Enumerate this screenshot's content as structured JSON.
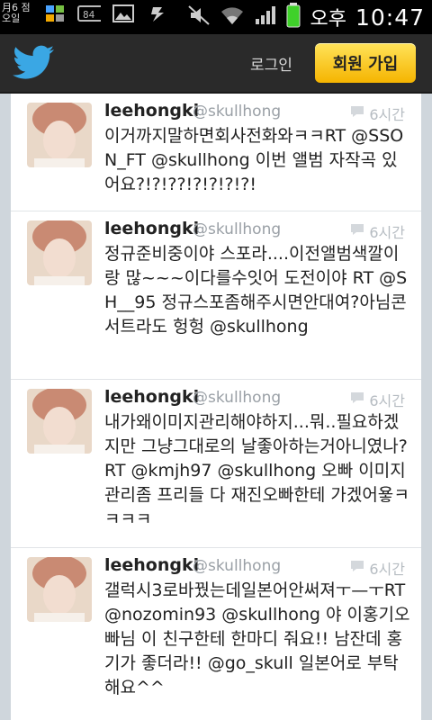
{
  "status_bar": {
    "left_text": "月6 점오일",
    "signal_label": "84",
    "time_ampm": "오후",
    "time": "10:47",
    "battery_color": "#3fd12a"
  },
  "header": {
    "logo_icon": "twitter-bird-icon",
    "login_label": "로그인",
    "signup_label": "회원 가입",
    "accent": "#f5b400"
  },
  "tweets": [
    {
      "name": "leehongki",
      "handle": "@skullhong",
      "time": "6시간",
      "text": "이거까지말하면회사전화와ㅋㅋRT @SSON_FT @skullhong 이번 앨범 자작곡 있어요?!?!??!?!?!?!?!"
    },
    {
      "name": "leehongki",
      "handle": "@skullhong",
      "time": "6시간",
      "text": "정규준비중이야 스포라....이전앨범색깔이랑 많~~~이다를수잇어 도전이야 RT @SH__95 정규스포좀해주시면안대여?아님콘서트라도 헝헝 @skullhong"
    },
    {
      "name": "leehongki",
      "handle": "@skullhong",
      "time": "6시간",
      "text": "내가왜이미지관리해야하지...뭐..필요하겠지만 그냥그대로의 날좋아하는거아니였나? RT @kmjh97 @skullhong 오빠 이미지관리좀 프리들 다 재진오빠한테 가겠어욯ㅋㅋㅋㅋ"
    },
    {
      "name": "leehongki",
      "handle": "@skullhong",
      "time": "6시간",
      "text": "갤럭시3로바꿨는데일본어안써져ㅜ—ㅜRT @nozomin93 @skullhong 야 이홍기오빠님 이 친구한테 한마디 줘요!! 남잔데 홍기가 좋더라!! @go_skull 일본어로 부탁해요^^"
    }
  ]
}
